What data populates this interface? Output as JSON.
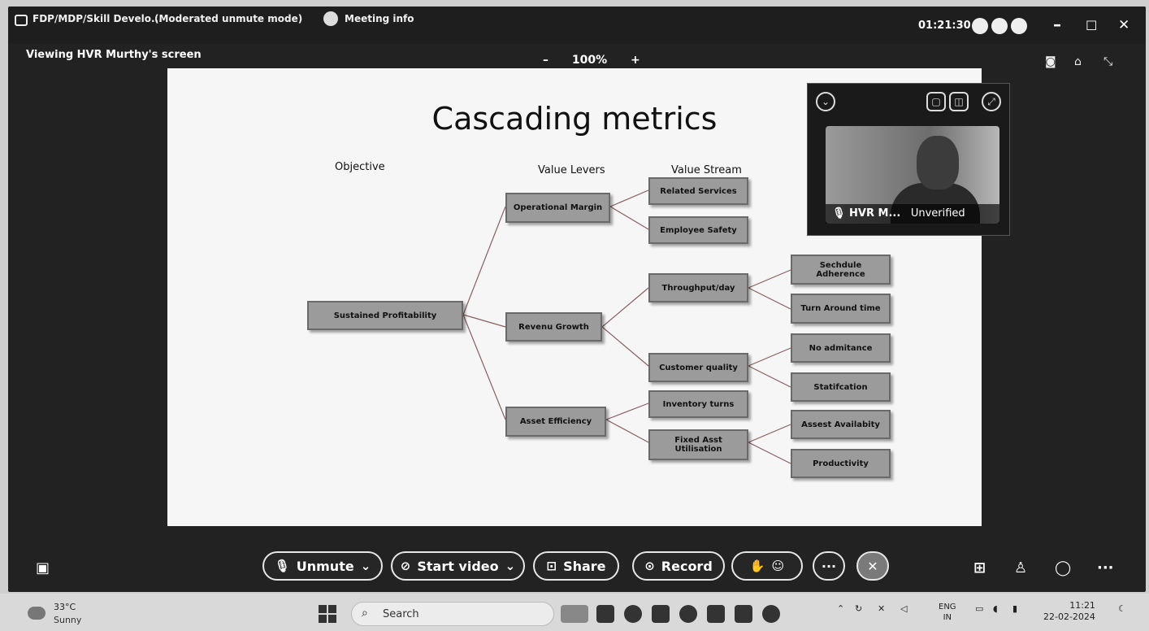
{
  "titlebar": {
    "meeting_title": "FDP/MDP/Skill Develo...",
    "mode": "(Moderated unmute mode)",
    "meeting_info": "Meeting info",
    "timer": "01:21:30",
    "min": "–",
    "max": "☐",
    "close": "✕"
  },
  "viewbar": {
    "viewing": "Viewing HVR Murthy's screen",
    "zoom_out": "–",
    "zoom": "100%",
    "zoom_in": "+"
  },
  "slide": {
    "title": "Cascading metrics",
    "col_objective": "Objective",
    "col_levers": "Value Levers",
    "col_stream": "Value Stream",
    "nodes": {
      "sustained": "Sustained Profitability",
      "op_margin": "Operational Margin",
      "revenue": "Revenu Growth",
      "asset_eff": "Asset Efficiency",
      "related": "Related Services",
      "emp_safety": "Employee Safety",
      "throughput": "Throughput/day",
      "cust_quality": "Customer quality",
      "inventory": "Inventory turns",
      "fixed_asset": "Fixed Asst Utilisation",
      "schedule": "Sechdule Adherence",
      "turnaround": "Turn Around time",
      "no_admit": "No admitance",
      "satisfaction": "Statifcation",
      "asset_avail": "Assest Availabity",
      "productivity": "Productivity"
    }
  },
  "video": {
    "name": "HVR M...",
    "status": "Unverified"
  },
  "controls": {
    "unmute": "Unmute",
    "start_video": "Start video",
    "share": "Share",
    "record": "Record",
    "more": "···",
    "end": "✕"
  },
  "taskbar": {
    "temp": "33°C",
    "condition": "Sunny",
    "search": "Search",
    "lang1": "ENG",
    "lang2": "IN",
    "time": "11:21",
    "date": "22-02-2024"
  }
}
